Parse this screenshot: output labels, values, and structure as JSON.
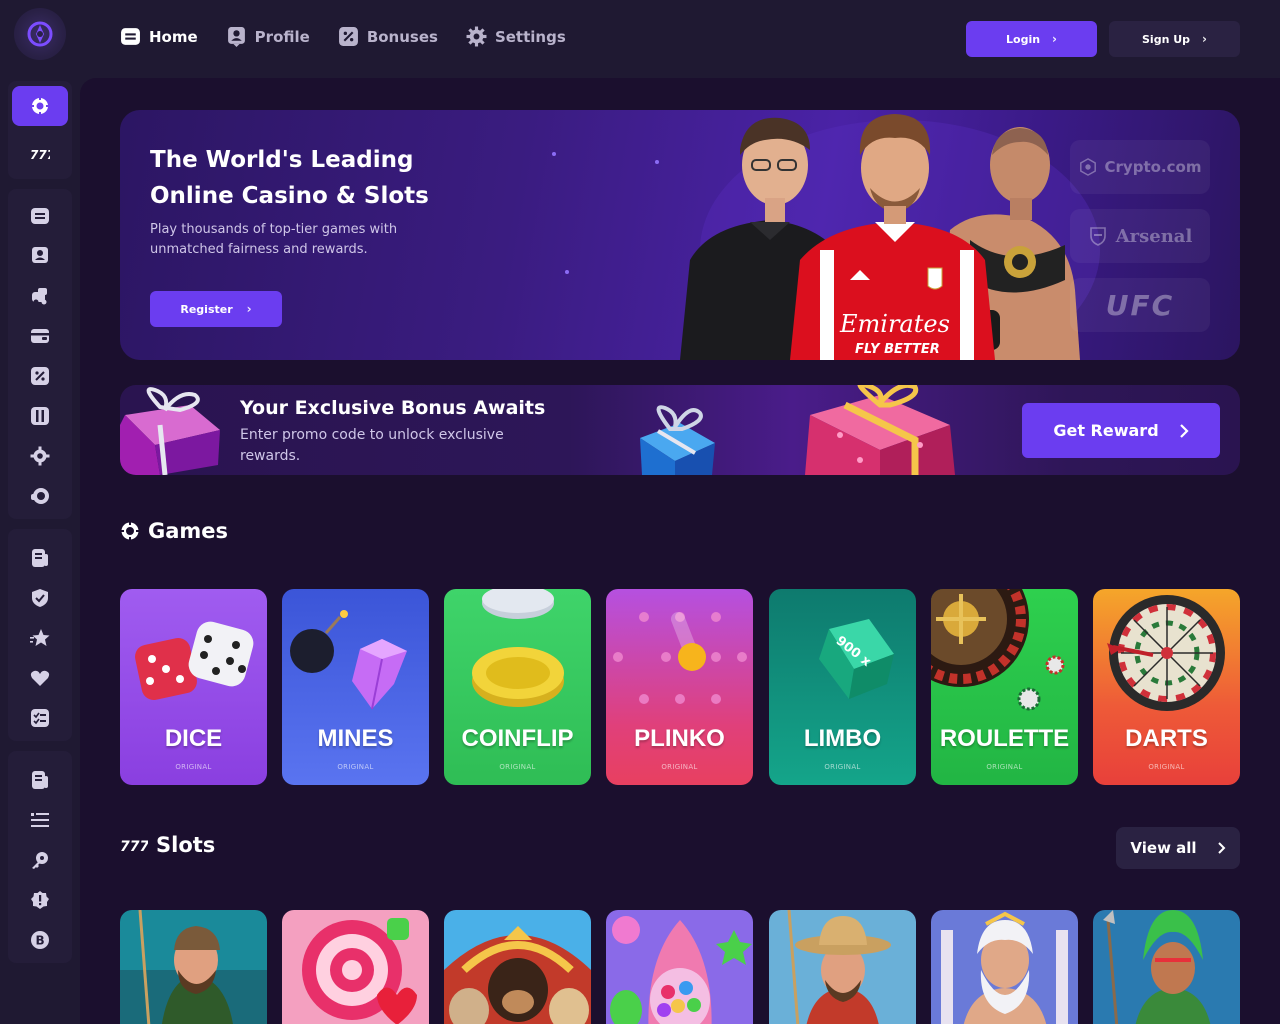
{
  "nav": {
    "items": [
      {
        "label": "Home",
        "icon": "home-icon",
        "active": true
      },
      {
        "label": "Profile",
        "icon": "profile-icon",
        "active": false
      },
      {
        "label": "Bonuses",
        "icon": "bonuses-icon",
        "active": false
      },
      {
        "label": "Settings",
        "icon": "settings-icon",
        "active": false
      }
    ],
    "login_label": "Login",
    "signup_label": "Sign Up"
  },
  "hero": {
    "title": "The World's Leading Online Casino & Slots",
    "subtitle": "Play thousands of top-tier games with unmatched fairness and rewards.",
    "register_label": "Register",
    "sponsors": [
      "Crypto.com",
      "Arsenal",
      "UFC"
    ],
    "jersey_text_1": "Emirates",
    "jersey_text_2": "FLY BETTER"
  },
  "bonus": {
    "title": "Your Exclusive Bonus Awaits",
    "subtitle": "Enter promo code to unlock exclusive rewards.",
    "button_label": "Get Reward"
  },
  "games": {
    "title": "Games",
    "items": [
      {
        "name": "DICE",
        "tag": "ORIGINAL"
      },
      {
        "name": "MINES",
        "tag": "ORIGINAL"
      },
      {
        "name": "COINFLIP",
        "tag": "ORIGINAL"
      },
      {
        "name": "PLINKO",
        "tag": "ORIGINAL"
      },
      {
        "name": "LIMBO",
        "tag": "ORIGINAL",
        "art_text": "900 x"
      },
      {
        "name": "ROULETTE",
        "tag": "ORIGINAL"
      },
      {
        "name": "DARTS",
        "tag": "ORIGINAL"
      }
    ]
  },
  "slots": {
    "title": "Slots",
    "view_all_label": "View all"
  },
  "colors": {
    "accent": "#6b3df0",
    "background": "#1b0f2e",
    "topbar": "#1f1932"
  }
}
